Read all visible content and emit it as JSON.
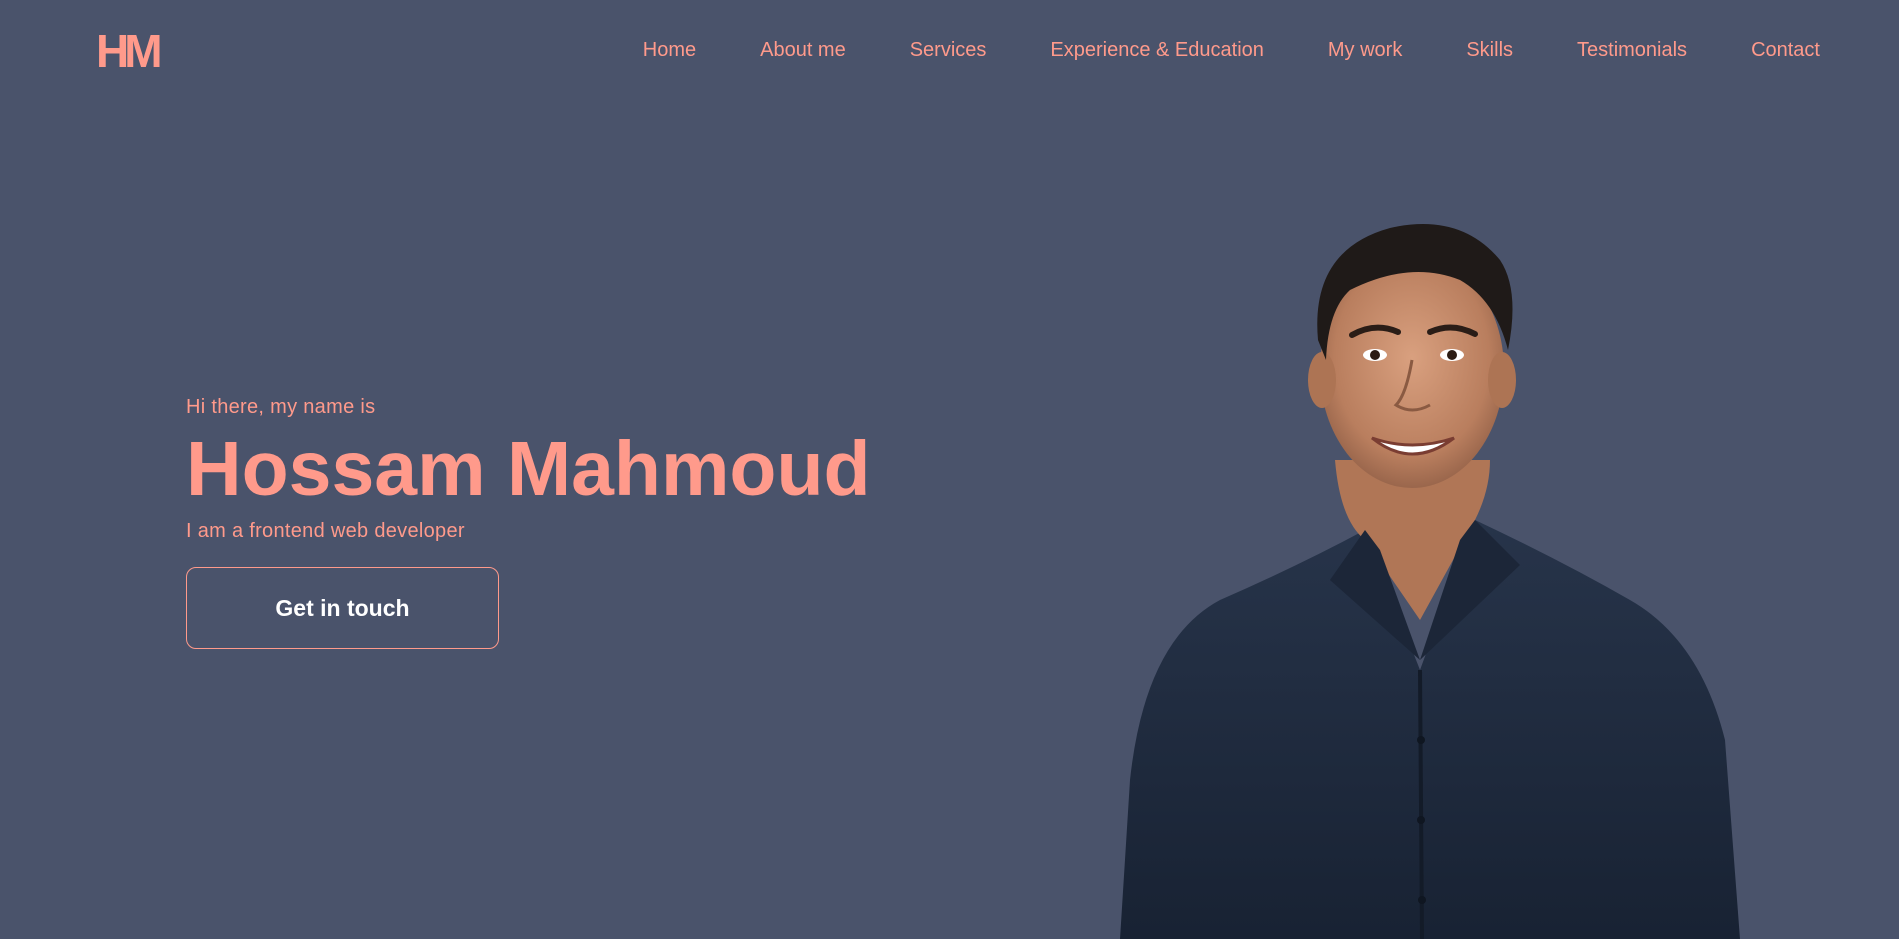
{
  "colors": {
    "background": "#4a536b",
    "accent": "#ff9a8b",
    "button_text": "#ffffff",
    "shirt": "#1f2a3a",
    "skin": "#c58d6c",
    "hair": "#1f1a18"
  },
  "logo": {
    "text": "HM"
  },
  "nav": {
    "items": [
      {
        "label": "Home"
      },
      {
        "label": "About me"
      },
      {
        "label": "Services"
      },
      {
        "label": "Experience & Education"
      },
      {
        "label": "My work"
      },
      {
        "label": "Skills"
      },
      {
        "label": "Testimonials"
      },
      {
        "label": "Contact"
      }
    ]
  },
  "hero": {
    "greeting": "Hi there, my name is",
    "name": "Hossam Mahmoud",
    "role": "I am a frontend web developer",
    "cta_label": "Get in touch"
  }
}
